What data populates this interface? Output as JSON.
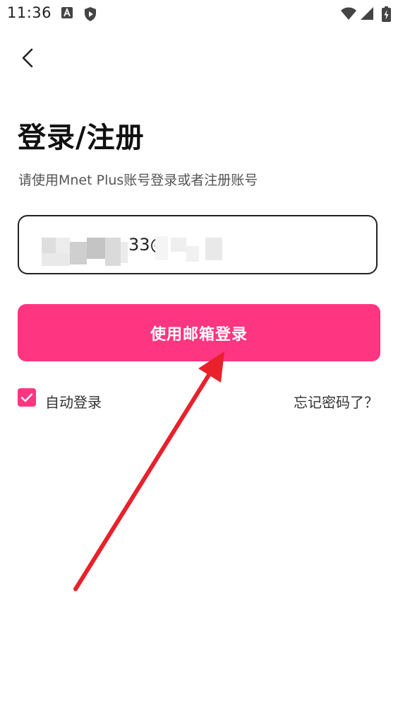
{
  "status_bar": {
    "time": "11:36",
    "icons": [
      "keyboard-a-icon",
      "shield-play-icon",
      "wifi-icon",
      "signal-icon",
      "battery-icon"
    ]
  },
  "nav": {
    "back_icon": "chevron-left-icon"
  },
  "title": "登录/注册",
  "subtitle": "请使用Mnet Plus账号登录或者注册账号",
  "email_field": {
    "value": "33@"
  },
  "login_button": {
    "label": "使用邮箱登录"
  },
  "auto_login": {
    "label": "自动登录",
    "checked": true
  },
  "forgot_password": {
    "label": "忘记密码了？"
  },
  "colors": {
    "accent": "#fe3580",
    "annotation_arrow": "#e8212b"
  }
}
